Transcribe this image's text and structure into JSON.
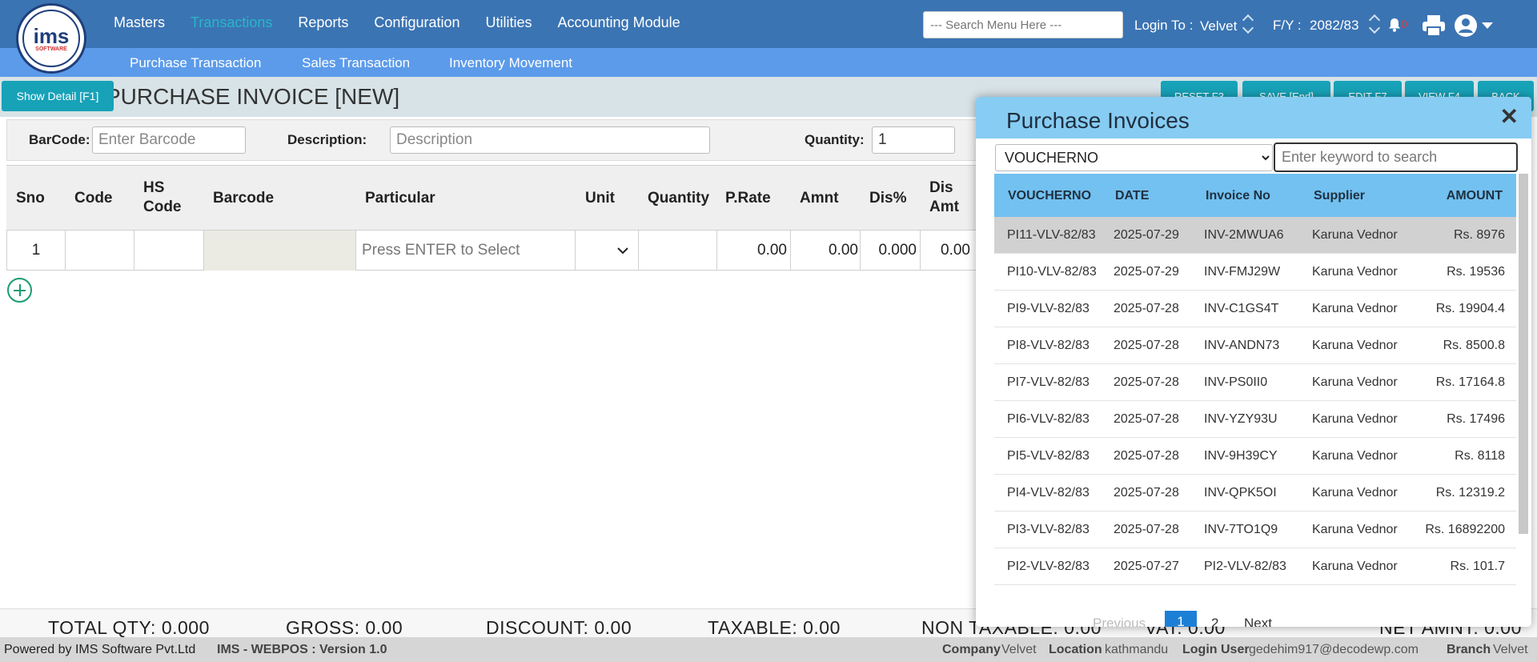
{
  "logo": {
    "main": "ims",
    "sub": "SOFTWARE"
  },
  "nav": {
    "items": [
      "Masters",
      "Transactions",
      "Reports",
      "Configuration",
      "Utilities",
      "Accounting Module"
    ],
    "active": "Transactions",
    "search_placeholder": "--- Search Menu Here ---",
    "login_label": "Login To :",
    "login_value": "Velvet",
    "fy_label": "F/Y :",
    "fy_value": "2082/83",
    "notification_count": "0"
  },
  "subnav": {
    "items": [
      "Purchase Transaction",
      "Sales Transaction",
      "Inventory Movement"
    ]
  },
  "toolbar": {
    "show_detail": "Show Detail [F1]",
    "title": "PURCHASE INVOICE [NEW]",
    "reset": "RESET F3",
    "save": "SAVE [End]",
    "edit": "EDIT F7",
    "view": "VIEW F4",
    "back": "BACK"
  },
  "entry": {
    "barcode_label": "BarCode:",
    "barcode_placeholder": "Enter Barcode",
    "description_label": "Description:",
    "description_placeholder": "Description",
    "quantity_label": "Quantity:",
    "quantity_value": "1"
  },
  "grid": {
    "headers": {
      "sno": "Sno",
      "code": "Code",
      "hs1": "HS",
      "hs2": "Code",
      "barcode": "Barcode",
      "particular": "Particular",
      "unit": "Unit",
      "quantity": "Quantity",
      "prate": "P.Rate",
      "amnt": "Amnt",
      "dis": "Dis%",
      "disamt1": "Dis",
      "disamt2": "Amt"
    },
    "row": {
      "sno": "1",
      "particular_placeholder": "Press ENTER to Select",
      "prate": "0.00",
      "amnt": "0.00",
      "dis": "0.000",
      "disamt": "0.00"
    }
  },
  "totals": {
    "qty": "TOTAL QTY: 0.000",
    "gross": "GROSS: 0.00",
    "discount": "DISCOUNT: 0.00",
    "taxable": "TAXABLE: 0.00",
    "nontaxable": "NON TAXABLE: 0.00",
    "vat": "VAT: 0.00",
    "net": "NET AMNT: 0.00"
  },
  "footer": {
    "powered": "Powered by IMS Software Pvt.Ltd",
    "version": "IMS - WEBPOS : Version 1.0",
    "company_label": "Company",
    "company": "Velvet",
    "location_label": "Location",
    "location": "kathmandu",
    "user_label": "Login User",
    "user": "gedehim917@decodewp.com",
    "branch_label": "Branch",
    "branch": "Velvet"
  },
  "modal": {
    "title": "Purchase Invoices",
    "filter_value": "VOUCHERNO",
    "search_placeholder": "Enter keyword to search",
    "columns": [
      "VOUCHERNO",
      "DATE",
      "Invoice No",
      "Supplier",
      "AMOUNT"
    ],
    "rows": [
      {
        "voucher": "PI11-VLV-82/83",
        "date": "2025-07-29",
        "invoice": "INV-2MWUA6",
        "supplier": "Karuna Vednor",
        "amount": "Rs. 8976"
      },
      {
        "voucher": "PI10-VLV-82/83",
        "date": "2025-07-29",
        "invoice": "INV-FMJ29W",
        "supplier": "Karuna Vednor",
        "amount": "Rs. 19536"
      },
      {
        "voucher": "PI9-VLV-82/83",
        "date": "2025-07-28",
        "invoice": "INV-C1GS4T",
        "supplier": "Karuna Vednor",
        "amount": "Rs. 19904.4"
      },
      {
        "voucher": "PI8-VLV-82/83",
        "date": "2025-07-28",
        "invoice": "INV-ANDN73",
        "supplier": "Karuna Vednor",
        "amount": "Rs. 8500.8"
      },
      {
        "voucher": "PI7-VLV-82/83",
        "date": "2025-07-28",
        "invoice": "INV-PS0II0",
        "supplier": "Karuna Vednor",
        "amount": "Rs. 17164.8"
      },
      {
        "voucher": "PI6-VLV-82/83",
        "date": "2025-07-28",
        "invoice": "INV-YZY93U",
        "supplier": "Karuna Vednor",
        "amount": "Rs. 17496"
      },
      {
        "voucher": "PI5-VLV-82/83",
        "date": "2025-07-28",
        "invoice": "INV-9H39CY",
        "supplier": "Karuna Vednor",
        "amount": "Rs. 8118"
      },
      {
        "voucher": "PI4-VLV-82/83",
        "date": "2025-07-28",
        "invoice": "INV-QPK5OI",
        "supplier": "Karuna Vednor",
        "amount": "Rs. 12319.2"
      },
      {
        "voucher": "PI3-VLV-82/83",
        "date": "2025-07-28",
        "invoice": "INV-7TO1Q9",
        "supplier": "Karuna Vednor",
        "amount": "Rs. 16892200"
      },
      {
        "voucher": "PI2-VLV-82/83",
        "date": "2025-07-27",
        "invoice": "PI2-VLV-82/83",
        "supplier": "Karuna Vednor",
        "amount": "Rs. 101.7"
      }
    ],
    "pager": {
      "previous": "Previous",
      "page1": "1",
      "page2": "2",
      "next": "Next"
    }
  }
}
